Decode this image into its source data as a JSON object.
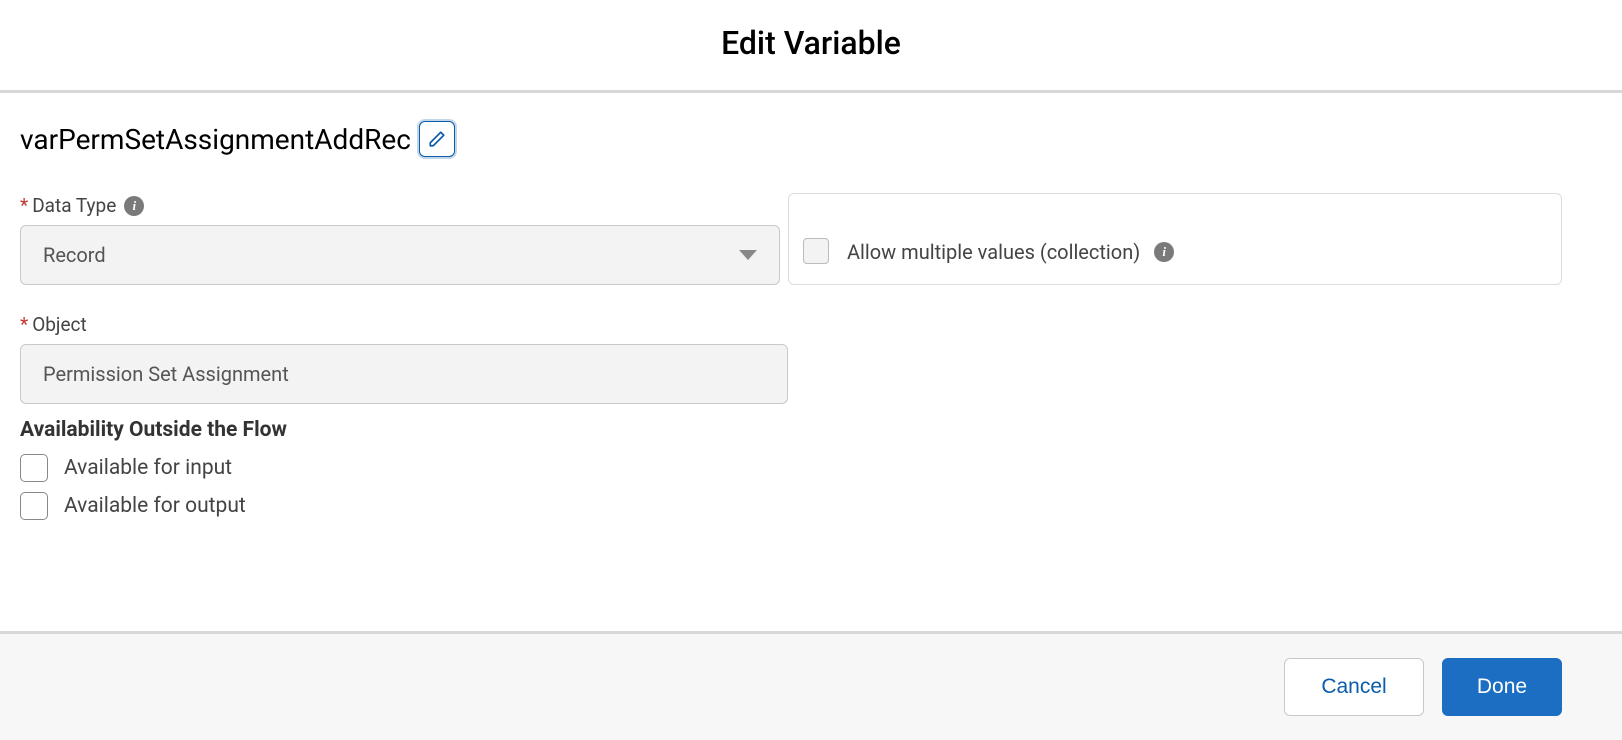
{
  "modal": {
    "title": "Edit Variable"
  },
  "variable": {
    "name": "varPermSetAssignmentAddRec"
  },
  "fields": {
    "dataTypeLabel": "Data Type",
    "dataTypeValue": "Record",
    "allowMultipleLabel": "Allow multiple values (collection)",
    "objectLabel": "Object",
    "objectValue": "Permission Set Assignment"
  },
  "availability": {
    "heading": "Availability Outside the Flow",
    "inputLabel": "Available for input",
    "outputLabel": "Available for output"
  },
  "footer": {
    "cancel": "Cancel",
    "done": "Done"
  }
}
